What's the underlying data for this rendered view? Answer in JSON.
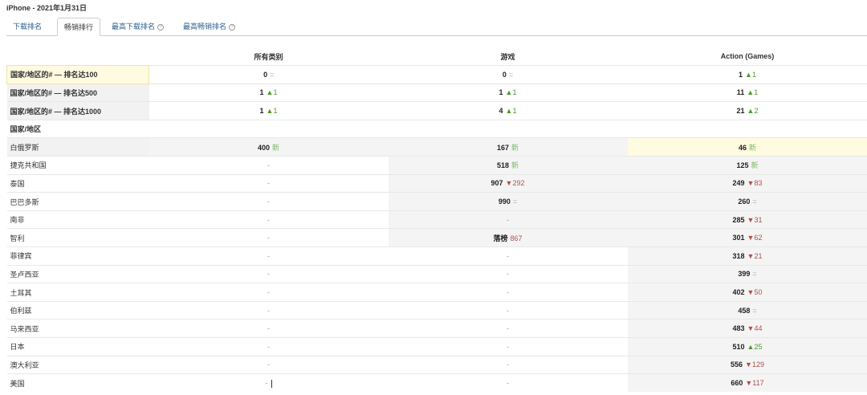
{
  "page": {
    "title": "iPhone - 2021年1月31日"
  },
  "tabs": [
    {
      "label": "下载排名",
      "help": false
    },
    {
      "label": "畅销排行",
      "help": false
    },
    {
      "label": "最高下载排名",
      "help": true
    },
    {
      "label": "最高畅销排名",
      "help": true
    }
  ],
  "columns": [
    "所有类别",
    "游戏",
    "Action (Games)"
  ],
  "summary": [
    {
      "label": "国家/地区的# — 排名达100",
      "cells": [
        {
          "value": "0",
          "change": "=",
          "dir": "eq"
        },
        {
          "value": "0",
          "change": "=",
          "dir": "eq"
        },
        {
          "value": "1",
          "change": "▲1",
          "dir": "up"
        }
      ]
    },
    {
      "label": "国家/地区的# — 排名达500",
      "cells": [
        {
          "value": "1",
          "change": "▲1",
          "dir": "up"
        },
        {
          "value": "1",
          "change": "▲1",
          "dir": "up"
        },
        {
          "value": "11",
          "change": "▲1",
          "dir": "up"
        }
      ]
    },
    {
      "label": "国家/地区的# — 排名达1000",
      "cells": [
        {
          "value": "1",
          "change": "▲1",
          "dir": "up"
        },
        {
          "value": "4",
          "change": "▲1",
          "dir": "up"
        },
        {
          "value": "21",
          "change": "▲2",
          "dir": "up"
        }
      ]
    }
  ],
  "section_label": "国家/地区",
  "rows": [
    {
      "country": "白俄罗斯",
      "cells": [
        {
          "value": "400",
          "change": "新",
          "dir": "new"
        },
        {
          "value": "167",
          "change": "新",
          "dir": "new"
        },
        {
          "value": "46",
          "change": "新",
          "dir": "new"
        }
      ]
    },
    {
      "country": "捷克共和国",
      "cells": [
        {
          "value": "-"
        },
        {
          "value": "518",
          "change": "新",
          "dir": "new"
        },
        {
          "value": "125",
          "change": "新",
          "dir": "new"
        }
      ]
    },
    {
      "country": "泰国",
      "cells": [
        {
          "value": "-"
        },
        {
          "value": "907",
          "change": "▼292",
          "dir": "down"
        },
        {
          "value": "249",
          "change": "▼83",
          "dir": "down"
        }
      ]
    },
    {
      "country": "巴巴多斯",
      "cells": [
        {
          "value": "-"
        },
        {
          "value": "990",
          "change": "=",
          "dir": "eq"
        },
        {
          "value": "260",
          "change": "=",
          "dir": "eq"
        }
      ]
    },
    {
      "country": "南非",
      "cells": [
        {
          "value": "-"
        },
        {
          "value": "-"
        },
        {
          "value": "285",
          "change": "▼31",
          "dir": "down"
        }
      ]
    },
    {
      "country": "智利",
      "cells": [
        {
          "value": "-"
        },
        {
          "value": "落榜",
          "change": "867",
          "dir": "down"
        },
        {
          "value": "301",
          "change": "▼62",
          "dir": "down"
        }
      ]
    },
    {
      "country": "菲律宾",
      "cells": [
        {
          "value": "-"
        },
        {
          "value": "-"
        },
        {
          "value": "318",
          "change": "▼21",
          "dir": "down"
        }
      ]
    },
    {
      "country": "圣卢西亚",
      "cells": [
        {
          "value": "-"
        },
        {
          "value": "-"
        },
        {
          "value": "399",
          "change": "=",
          "dir": "eq"
        }
      ]
    },
    {
      "country": "土耳其",
      "cells": [
        {
          "value": "-"
        },
        {
          "value": "-"
        },
        {
          "value": "402",
          "change": "▼50",
          "dir": "down"
        }
      ]
    },
    {
      "country": "伯利兹",
      "cells": [
        {
          "value": "-"
        },
        {
          "value": "-"
        },
        {
          "value": "458",
          "change": "=",
          "dir": "eq"
        }
      ]
    },
    {
      "country": "马来西亚",
      "cells": [
        {
          "value": "-"
        },
        {
          "value": "-"
        },
        {
          "value": "483",
          "change": "▼44",
          "dir": "down"
        }
      ]
    },
    {
      "country": "日本",
      "cells": [
        {
          "value": "-"
        },
        {
          "value": "-"
        },
        {
          "value": "510",
          "change": "▲25",
          "dir": "up"
        }
      ]
    },
    {
      "country": "澳大利亚",
      "cells": [
        {
          "value": "-"
        },
        {
          "value": "-"
        },
        {
          "value": "556",
          "change": "▼129",
          "dir": "down"
        }
      ]
    },
    {
      "country": "美国",
      "cells": [
        {
          "value": "-"
        },
        {
          "value": "-"
        },
        {
          "value": "660",
          "change": "▼117",
          "dir": "down"
        }
      ]
    }
  ]
}
